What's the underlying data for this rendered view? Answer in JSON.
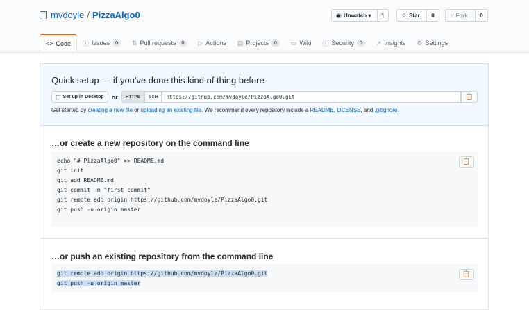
{
  "repo": {
    "owner": "mvdoyle",
    "separator": "/",
    "name": "PizzaAlgo0"
  },
  "actions": [
    {
      "label": "Unwatch ▾",
      "icon": "◉",
      "count": "1"
    },
    {
      "label": "Star",
      "icon": "☆",
      "count": "0"
    },
    {
      "label": "Fork",
      "icon": "⑂",
      "count": "0"
    }
  ],
  "tabs": [
    {
      "icon": "<>",
      "label": "Code",
      "badge": ""
    },
    {
      "icon": "ⓘ",
      "label": "Issues",
      "badge": "0"
    },
    {
      "icon": "⇅",
      "label": "Pull requests",
      "badge": "0"
    },
    {
      "icon": "▷",
      "label": "Actions",
      "badge": ""
    },
    {
      "icon": "▤",
      "label": "Projects",
      "badge": "0"
    },
    {
      "icon": "▭",
      "label": "Wiki",
      "badge": ""
    },
    {
      "icon": "ⓘ",
      "label": "Security",
      "badge": "0"
    },
    {
      "icon": "↗",
      "label": "Insights",
      "badge": ""
    },
    {
      "icon": "⚙",
      "label": "Settings",
      "badge": ""
    }
  ],
  "quick_setup": {
    "title": "Quick setup — if you've done this kind of thing before",
    "desktop_button": "Set up in Desktop",
    "or": "or",
    "https": "HTTPS",
    "ssh": "SSH",
    "url": "https://github.com/mvdoyle/PizzaAlgo0.git",
    "help": {
      "t1": "Get started by ",
      "link1": "creating a new file",
      "t2": " or ",
      "link2": "uploading an existing file",
      "t3": ". We recommend every repository include a ",
      "link3": "README",
      "t4": ", ",
      "link4": "LICENSE",
      "t5": ", and ",
      "link5": ".gitignore",
      "t6": "."
    }
  },
  "new_repo": {
    "title": "…or create a new repository on the command line",
    "lines": [
      "echo \"# PizzaAlgo0\" >> README.md",
      "git init",
      "git add README.md",
      "git commit -m \"first commit\"",
      "git remote add origin https://github.com/mvdoyle/PizzaAlgo0.git",
      "git push -u origin master"
    ]
  },
  "push_repo": {
    "title": "…or push an existing repository from the command line",
    "lines": [
      "git remote add origin https://github.com/mvdoyle/PizzaAlgo0.git",
      "git push -u origin master"
    ]
  }
}
